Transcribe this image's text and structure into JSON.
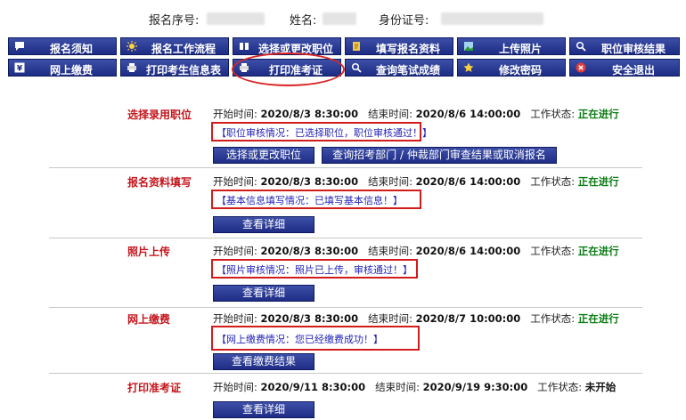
{
  "header": {
    "reg_no_label": "报名序号:",
    "name_label": "姓名:",
    "id_label": "身份证号:"
  },
  "nav": [
    {
      "label": "报名须知",
      "icon": "speech-bubble-icon"
    },
    {
      "label": "报名工作流程",
      "icon": "sun-icon"
    },
    {
      "label": "选择或更改职位",
      "icon": "book-icon"
    },
    {
      "label": "填写报名资料",
      "icon": "notebook-icon"
    },
    {
      "label": "上传照片",
      "icon": "picture-icon"
    },
    {
      "label": "职位审核结果",
      "icon": "magnifier-icon"
    },
    {
      "label": "网上缴费",
      "icon": "yen-icon"
    },
    {
      "label": "打印考生信息表",
      "icon": "printer-icon"
    },
    {
      "label": "打印准考证",
      "icon": "printer-icon"
    },
    {
      "label": "查询笔试成绩",
      "icon": "magnifier-icon"
    },
    {
      "label": "修改密码",
      "icon": "star-icon"
    },
    {
      "label": "安全退出",
      "icon": "exit-icon"
    }
  ],
  "labels": {
    "start": "开始时间:",
    "end": "结束时间:",
    "status": "工作状态:"
  },
  "steps": [
    {
      "title": "选择录用职位",
      "start": "2020/8/3 8:30:00",
      "end": "2020/8/6 14:00:00",
      "status": "正在进行",
      "note": "【职位审核情况：已选择职位，职位审核通过！】",
      "buttons": [
        "选择或更改职位",
        "查询招考部门 / 仲裁部门审查结果或取消报名"
      ]
    },
    {
      "title": "报名资料填写",
      "start": "2020/8/3 8:30:00",
      "end": "2020/8/6 14:00:00",
      "status": "正在进行",
      "note": "【基本信息填写情况：已填写基本信息！】",
      "buttons": [
        "查看详细"
      ]
    },
    {
      "title": "照片上传",
      "start": "2020/8/3 8:30:00",
      "end": "2020/8/6 14:00:00",
      "status": "正在进行",
      "note": "【照片审核情况：照片已上传，审核通过！】",
      "buttons": [
        "查看详细"
      ]
    },
    {
      "title": "网上缴费",
      "start": "2020/8/3 8:30:00",
      "end": "2020/8/7 10:00:00",
      "status": "正在进行",
      "note": "【网上缴费情况：您已经缴费成功！】",
      "buttons": [
        "查看缴费结果"
      ]
    },
    {
      "title": "打印准考证",
      "start": "2020/9/11 8:30:00",
      "end": "2020/9/19 9:30:00",
      "status": "未开始",
      "buttons": [
        "查看详细"
      ]
    }
  ],
  "colors": {
    "nav_bg": "#2a3a94",
    "title_red": "#c4151c",
    "status_green": "#0a7d13",
    "note_blue": "#2424b8",
    "highlight_red": "#d92626"
  }
}
